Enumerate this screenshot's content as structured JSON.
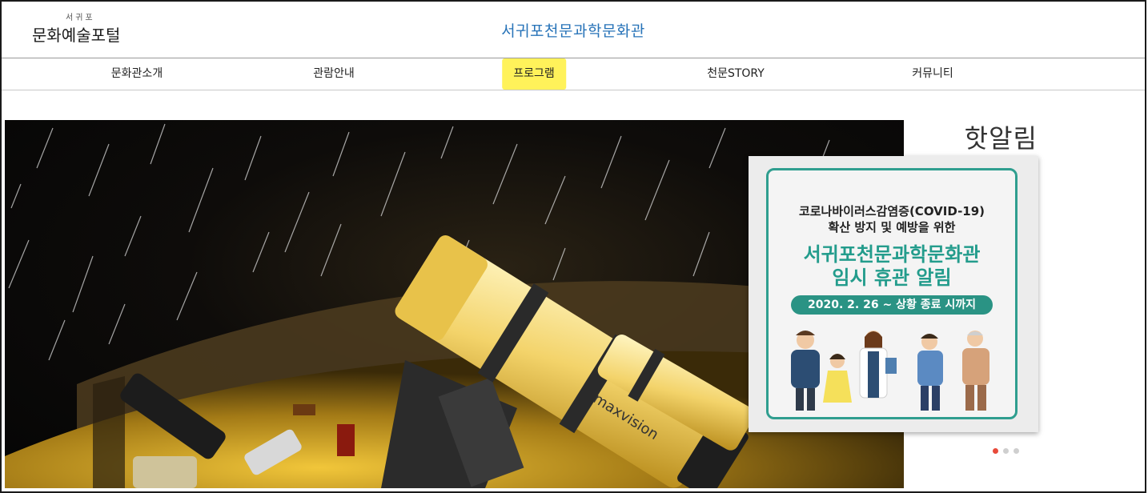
{
  "header": {
    "logo_small": "서귀포",
    "logo_main": "문화예술포털",
    "site_title": "서귀포천문과학문화관"
  },
  "nav": {
    "items": [
      {
        "label": "문화관소개"
      },
      {
        "label": "관람안내"
      },
      {
        "label": "프로그램",
        "highlighted": true
      },
      {
        "label": "천문STORY"
      },
      {
        "label": "커뮤니티"
      }
    ]
  },
  "hero": {
    "telescope_brand": "maxvision"
  },
  "notice": {
    "title": "핫알림",
    "popup": {
      "line1": "코로나바이러스감염증(COVID-19)",
      "line2": "확산 방지 및 예방을 위한",
      "headline1": "서귀포천문과학문화관",
      "headline2": "임시 휴관 알림",
      "period": "2020. 2. 26 ~ 상황 종료 시까지"
    },
    "pager": {
      "count": 3,
      "active": 1
    }
  },
  "colors": {
    "title_blue": "#2773b8",
    "highlight_yellow": "#fff25a",
    "popup_teal": "#2a9384",
    "pager_active": "#e84a3a"
  }
}
